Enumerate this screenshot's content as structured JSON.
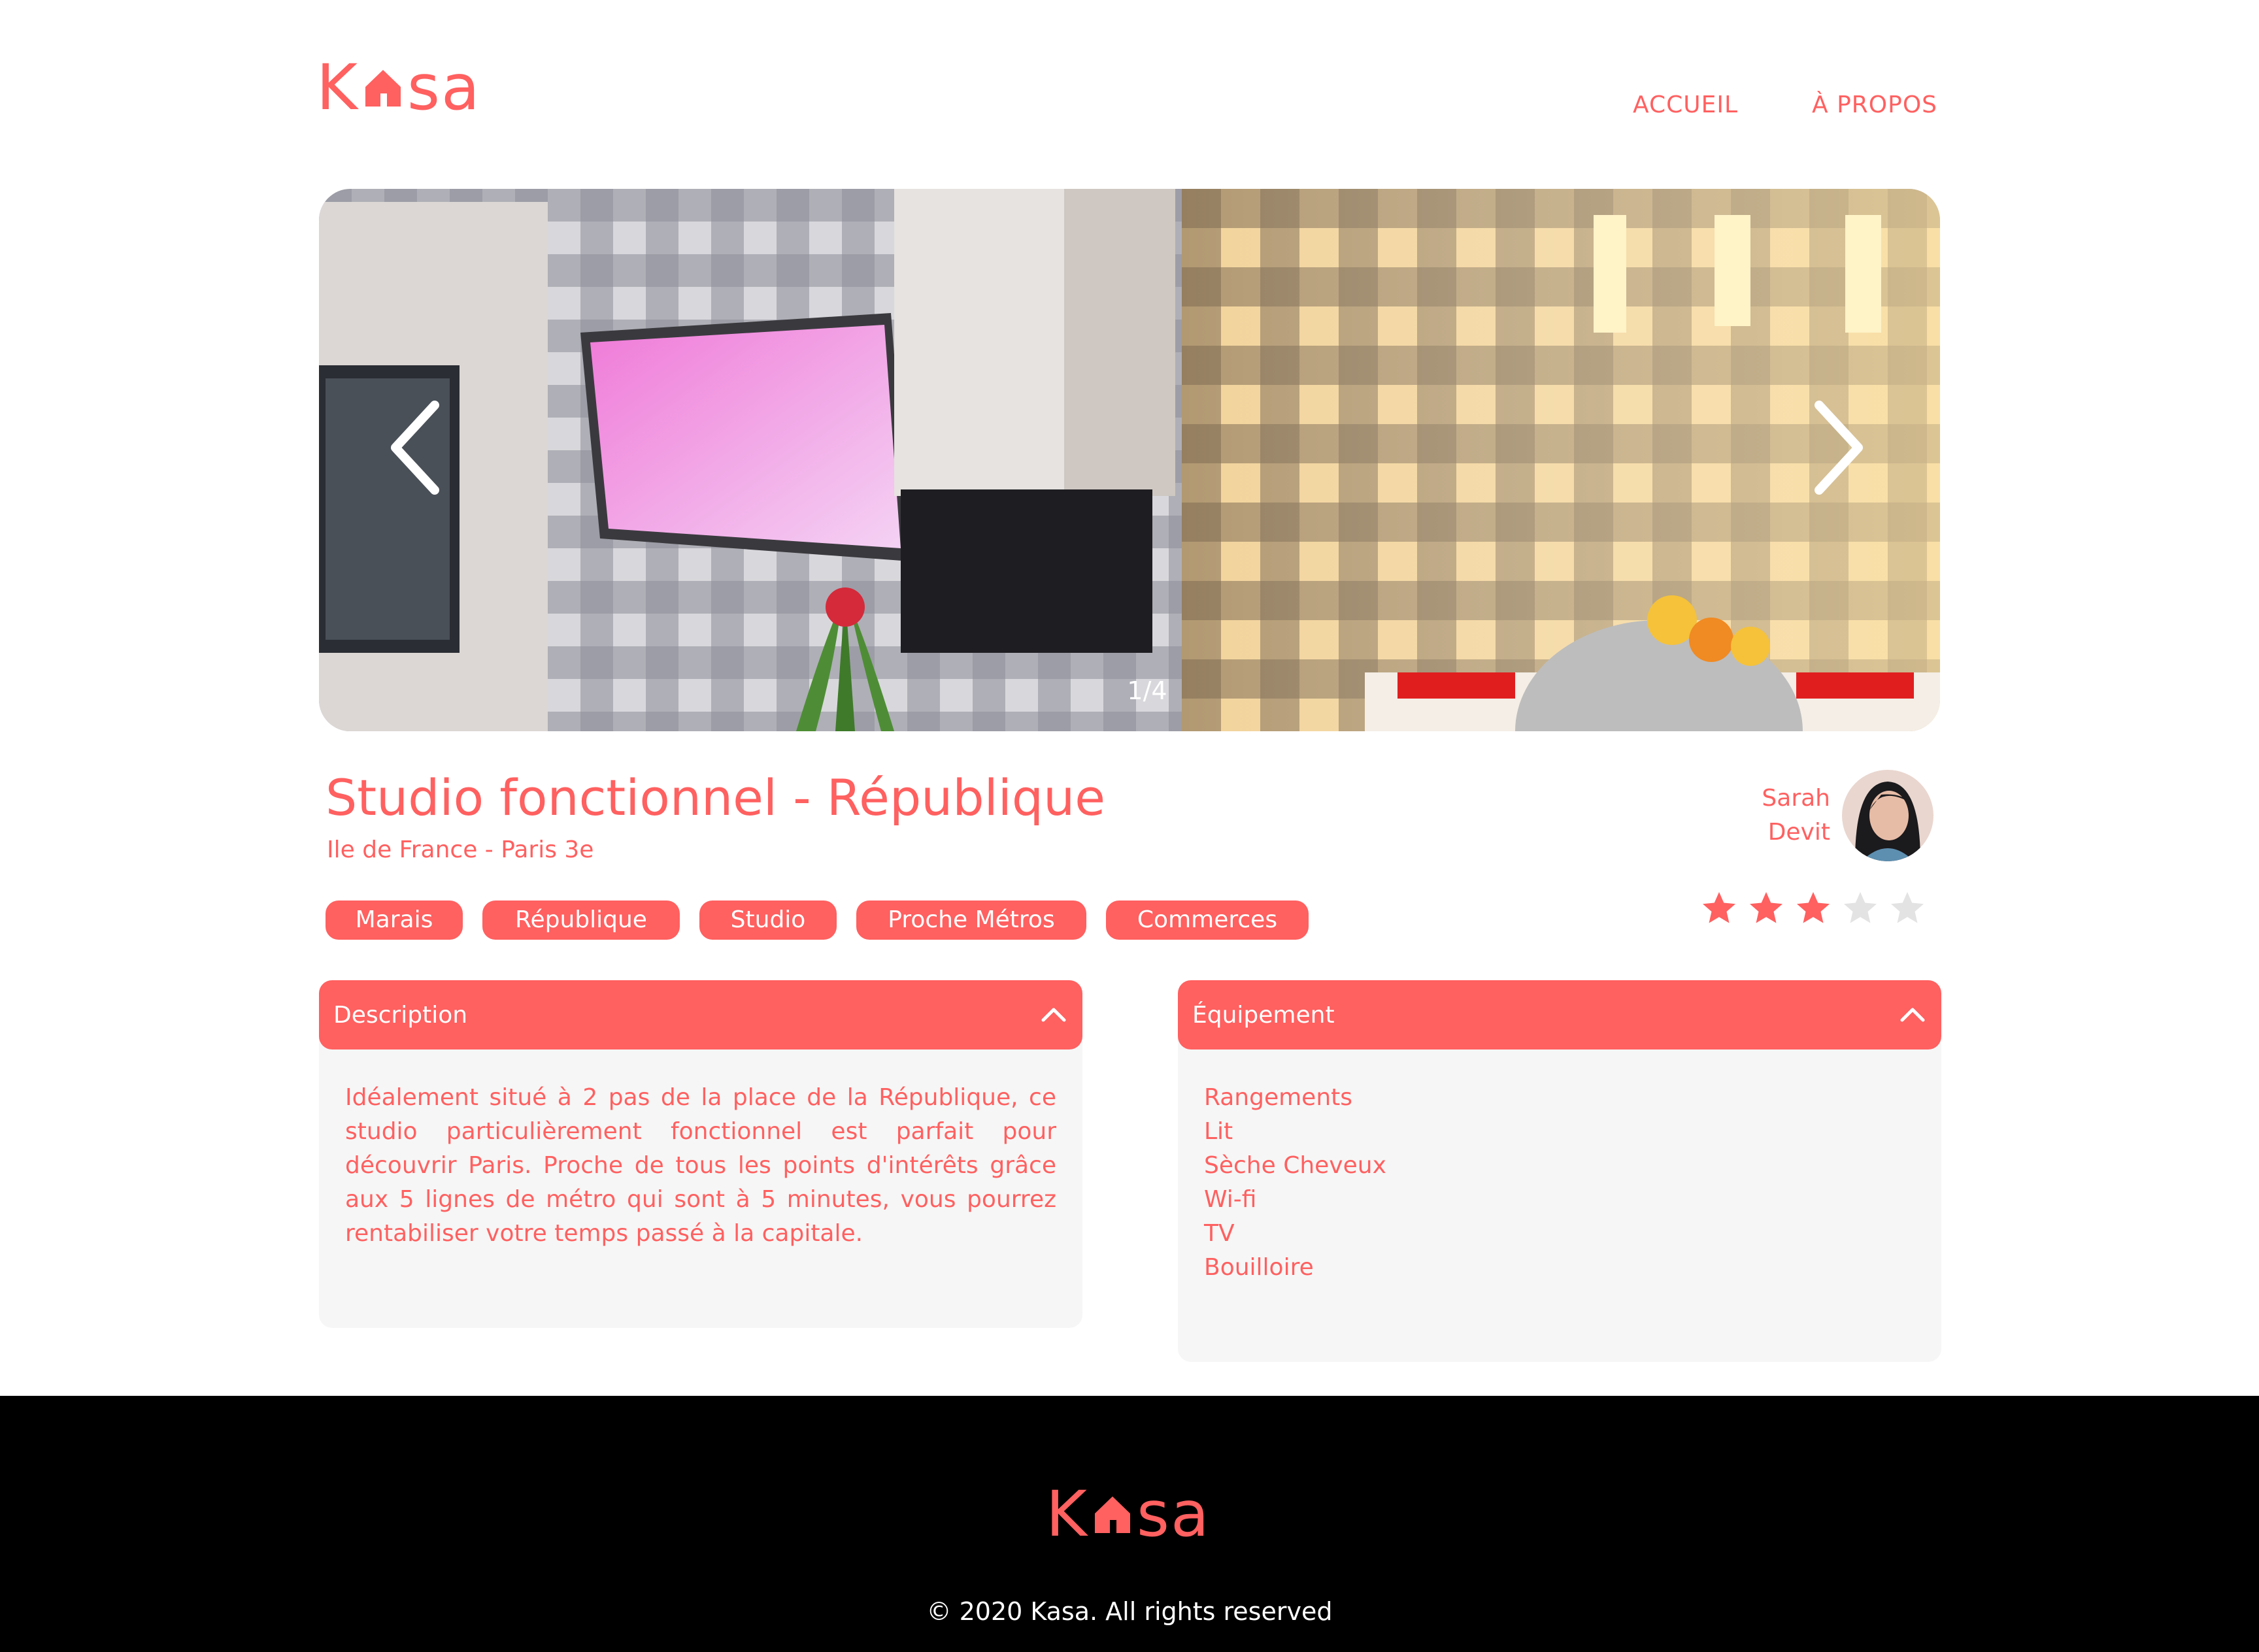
{
  "brand": {
    "logo_left": "K",
    "logo_right": "sa",
    "color": "#ff6060"
  },
  "nav": {
    "home": "ACCUEIL",
    "about": "À PROPOS"
  },
  "carousel": {
    "counter": "1/4",
    "prev_icon": "chevron-left-icon",
    "next_icon": "chevron-right-icon"
  },
  "listing": {
    "title": "Studio fonctionnel - République",
    "location": "Ile de France - Paris 3e",
    "tags": [
      "Marais",
      "République",
      "Studio",
      "Proche Métros",
      "Commerces"
    ],
    "host": {
      "first_name": "Sarah",
      "last_name": "Devit"
    },
    "rating": 3,
    "rating_max": 5
  },
  "description": {
    "label": "Description",
    "text": "Idéalement situé à 2 pas de la place de la République, ce studio particulièrement fonctionnel est parfait pour découvrir Paris. Proche de tous les points d'intérêts grâce aux 5 lignes de métro qui sont à 5 minutes, vous pourrez rentabiliser votre temps passé à la capitale."
  },
  "equipment": {
    "label": "Équipement",
    "items": [
      "Rangements",
      "Lit",
      "Sèche Cheveux",
      "Wi-fi",
      "TV",
      "Bouilloire"
    ]
  },
  "footer": {
    "copyright": "© 2020 Kasa. All rights reserved"
  },
  "colors": {
    "accent": "#ff6060",
    "panel_bg": "#f6f6f6",
    "star_off": "#e3e3e3",
    "footer_bg": "#000000"
  }
}
